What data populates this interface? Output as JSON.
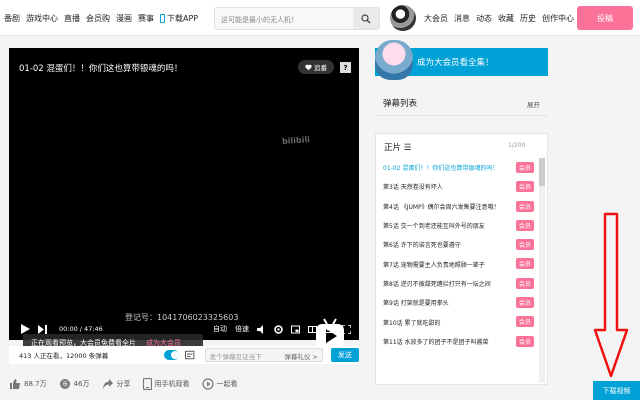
{
  "nav": {
    "items": [
      "番剧",
      "游戏中心",
      "直播",
      "会员购",
      "漫画",
      "赛事"
    ],
    "download_app": "下载APP"
  },
  "search": {
    "placeholder": "这可能是最小的无人机！"
  },
  "user_nav": [
    "大会员",
    "消息",
    "动态",
    "收藏",
    "历史",
    "创作中心"
  ],
  "post_button": "投稿",
  "player": {
    "title": "01-02  混蛋们！！你们这也算带银魂的吗！",
    "follow_label": "追番",
    "watermark": "bilibili",
    "preview_text": "正在观看预览，大会员免费看全片",
    "preview_cta": "成为大会员",
    "register_id": "登记号：1041706023325603",
    "time": "00:00 / 47:46",
    "auto_label": "自动",
    "speed_label": "倍速"
  },
  "stats": {
    "viewers": "413 人正在看，12000 条弹幕",
    "danmu_placeholder": "发个弹幕见证当下",
    "danmu_etiquette": "弹幕礼仪 >",
    "send_label": "发送"
  },
  "actions": [
    {
      "icon": "like-icon",
      "label": "88.7万"
    },
    {
      "icon": "coin-icon",
      "label": "46万"
    },
    {
      "icon": "share-icon",
      "label": "分享"
    },
    {
      "icon": "phone-icon",
      "label": "用手机观看"
    },
    {
      "icon": "watch-together-icon",
      "label": "一起看"
    }
  ],
  "sidebar": {
    "vip_banner": "成为大会员看全集！",
    "danmu_list_title": "弹幕列表",
    "danmu_list_toggle": "展开",
    "episodes_title": "正片",
    "episodes_count": "1/200",
    "member_badge": "会员",
    "episodes": [
      "01-02  混蛋们！！你们这也算带银魂的吗！",
      "第3话  天然卷没有坏人",
      "第4话  《JUMP》偶尔会周六发售要注意哦！",
      "第5话  交一个到老还能互叫外号的朋友",
      "第6话  许下的诺言死也要遵守",
      "第7话  宠物需要主人负责地照顾一辈子",
      "第8话  逆刃不披甜死缠拦打只有一坛之间",
      "第9话  打架就是要用拳头",
      "第10话  累了就吃甜的",
      "第11话  水放多了的团子不是团子叫酱菜"
    ]
  },
  "download_video": "下载视频",
  "colors": {
    "accent": "#00a1d6",
    "pink": "#fb7299",
    "arrow": "#e11"
  }
}
